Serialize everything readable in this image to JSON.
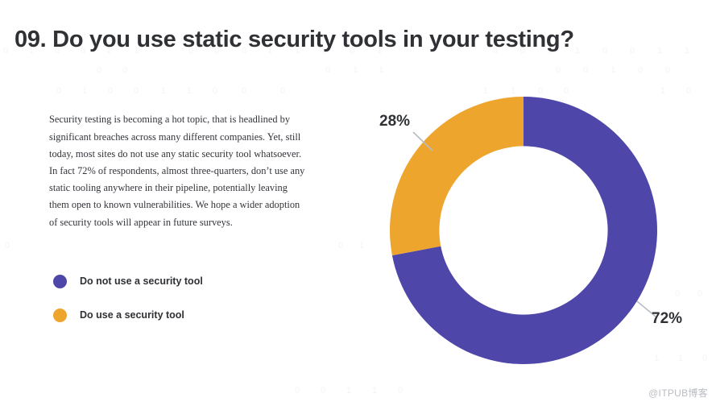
{
  "slide": {
    "title": "09. Do you use static security tools in your testing?",
    "body_text": "Security testing is becoming a hot topic, that is headlined by significant breaches across many different companies. Yet, still today, most sites do not use any static security tool whatsoever. In fact 72% of respondents, almost three-quarters, don’t use any static tooling anywhere in their pipeline, potentially leaving them open to known vulnerabilities. We hope a wider adoption of security tools will appear in future surveys.",
    "watermark": "@ITPUB博客",
    "background_digits": "0 1 0 0 1 1 0 0 0 1 1 0 0 1 0 0"
  },
  "colors": {
    "purple": "#4e46a8",
    "orange": "#eda52e",
    "title": "#2f3135",
    "body": "#33353a",
    "leader_line": "#b9bcc2",
    "background": "#ffffff",
    "binary_texture": "#f4f4f6",
    "watermark": "#b9bcc2"
  },
  "legend": {
    "items": [
      {
        "label": "Do not use a security tool",
        "color": "#4e46a8",
        "swatch_name": "legend-swatch-purple"
      },
      {
        "label": "Do use a security tool",
        "color": "#eda52e",
        "swatch_name": "legend-swatch-orange"
      }
    ]
  },
  "chart_data": {
    "type": "pie",
    "variant": "donut",
    "title": "09. Do you use static security tools in your testing?",
    "labels": [
      "Do not use a security tool",
      "Do use a security tool"
    ],
    "values": [
      72,
      28
    ],
    "unit": "%",
    "data_labels": [
      "72%",
      "28%"
    ],
    "colors": [
      "#4e46a8",
      "#eda52e"
    ],
    "start_angle_deg": 0,
    "direction": "clockwise",
    "inner_radius_ratio": 0.63,
    "legend_position": "left",
    "grid": false,
    "xlabel": "",
    "ylabel": ""
  }
}
